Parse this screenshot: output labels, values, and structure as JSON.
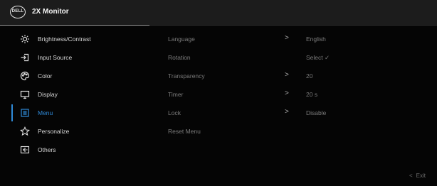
{
  "header": {
    "logo_text": "DELL",
    "title": "2X Monitor"
  },
  "menu": {
    "items": [
      {
        "label": "Brightness/Contrast",
        "icon": "brightness-icon"
      },
      {
        "label": "Input Source",
        "icon": "input-source-icon"
      },
      {
        "label": "Color",
        "icon": "color-icon"
      },
      {
        "label": "Display",
        "icon": "display-icon"
      },
      {
        "label": "Menu",
        "icon": "menu-icon",
        "active": true
      },
      {
        "label": "Personalize",
        "icon": "star-icon"
      },
      {
        "label": "Others",
        "icon": "others-icon"
      }
    ]
  },
  "submenu": {
    "items": [
      {
        "label": "Language",
        "chevron": ">"
      },
      {
        "label": "Rotation",
        "chevron": ""
      },
      {
        "label": "Transparency",
        "chevron": ">"
      },
      {
        "label": "Timer",
        "chevron": ">"
      },
      {
        "label": "Lock",
        "chevron": ">"
      },
      {
        "label": "Reset Menu",
        "chevron": ""
      }
    ]
  },
  "values": {
    "items": [
      "English",
      "Select ✓",
      "20",
      "20 s",
      "Disable",
      ""
    ]
  },
  "footer": {
    "exit_arrow": "<",
    "exit_label": "Exit"
  },
  "colors": {
    "accent": "#2f8ad8",
    "header_bg": "#1c1c1c",
    "background": "#050505"
  }
}
